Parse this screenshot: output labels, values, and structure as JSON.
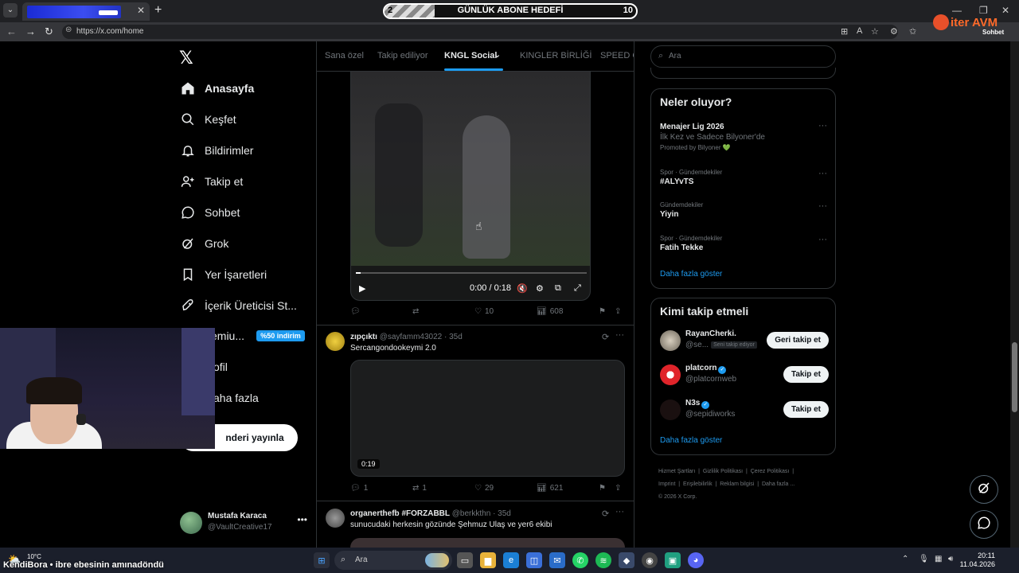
{
  "browser": {
    "tab_close": "✕",
    "new_tab": "+",
    "url": "https://x.com/home",
    "goal": {
      "left_value": "2",
      "title": "GÜNLÜK ABONE HEDEFİ",
      "right_value": "10",
      "progress": 0.2
    },
    "brand_logo_text": "iter AVM",
    "brand_sub": "Sohbet"
  },
  "nav": {
    "logo": "𝕏",
    "items": [
      {
        "label": "Anasayfa",
        "icon": "home-icon",
        "active": true
      },
      {
        "label": "Keşfet",
        "icon": "search-icon"
      },
      {
        "label": "Bildirimler",
        "icon": "bell-icon"
      },
      {
        "label": "Takip et",
        "icon": "follow-icon"
      },
      {
        "label": "Sohbet",
        "icon": "chat-icon"
      },
      {
        "label": "Grok",
        "icon": "grok-icon"
      },
      {
        "label": "Yer İşaretleri",
        "icon": "bookmark-icon"
      },
      {
        "label": "İçerik Üreticisi St...",
        "icon": "rocket-icon"
      },
      {
        "label": "emiu...",
        "icon": "premium-icon"
      },
      {
        "label": "ofil",
        "icon": "profile-icon"
      },
      {
        "label": "aha fazla",
        "icon": "more-icon"
      }
    ],
    "premium_badge": "%50 indirim",
    "post_button": "nderi yayınla",
    "profile": {
      "name": "Mustafa Karaca",
      "handle": "@VaultCreative17",
      "more": "•••"
    }
  },
  "stream": {
    "overlay_title": "KendiBora • ibre ebesinin amınadöndü"
  },
  "timeline": {
    "tabs": [
      "Sana özel",
      "Takip ediliyor",
      "KNGL Social",
      "KINGLER BİRLİĞİ",
      "SPEED G"
    ],
    "active_tab_chevron": "⌄",
    "video1": {
      "time": "0:00 / 0:18",
      "progress": 0.02
    },
    "tweet1_actions": {
      "replies": "",
      "reposts": "",
      "likes": "10",
      "views": "608"
    },
    "tweet2": {
      "name": "zıpçıktı",
      "handle": "@sayfamm43022 · 35d",
      "text": "Sercangondookeymi 2.0",
      "duration": "0:19",
      "replies": "1",
      "reposts": "1",
      "likes": "29",
      "views": "621"
    },
    "tweet3": {
      "name": "organerthefb #FORZABBL",
      "handle": "@berkkthn · 35d",
      "text": "sunucudaki herkesin gözünde Şehmuz Ulaş ve yer6 ekibi"
    }
  },
  "sidebar": {
    "search_placeholder": "Ara",
    "trends_title": "Neler oluyor?",
    "trends": [
      {
        "meta": "",
        "name": "Menajer Lig 2026",
        "sub": "İlk Kez ve Sadece Bilyoner'de",
        "promo": "Promoted by Bilyoner 💚"
      },
      {
        "meta": "Spor · Gündemdekiler",
        "name": "#ALYvTS",
        "sub": "",
        "promo": ""
      },
      {
        "meta": "Gündemdekiler",
        "name": "Yiyin",
        "sub": "",
        "promo": ""
      },
      {
        "meta": "Spor · Gündemdekiler",
        "name": "Fatih Tekke",
        "sub": "",
        "promo": ""
      }
    ],
    "trend_more_dots": "···",
    "show_more": "Daha fazla göster",
    "who_title": "Kimi takip etmeli",
    "who": [
      {
        "name": "RayanCherki.",
        "handle": "@se...",
        "tag": "Seni takip ediyor",
        "button": "Geri takip et",
        "verified": false
      },
      {
        "name": "platcorn",
        "handle": "@platcornweb",
        "tag": "",
        "button": "Takip et",
        "verified": true
      },
      {
        "name": "N3s",
        "handle": "@sepidiworks",
        "tag": "",
        "button": "Takip et",
        "verified": true
      }
    ],
    "who_more": "Daha fazla göster",
    "footer": [
      "Hizmet Şartları",
      "Gizlilik Politikası",
      "Çerez Politikası",
      "Imprint",
      "Erişilebilirlik",
      "Reklam bilgisi",
      "Daha fazla ...",
      "© 2026 X Corp."
    ]
  },
  "taskbar": {
    "weather": "10°C",
    "search": "Ara",
    "time": "20:11",
    "date": "11.04.2026"
  },
  "colors": {
    "accent": "#1d9bf0",
    "background": "#000000",
    "border": "#2f3336",
    "muted": "#71767b"
  }
}
